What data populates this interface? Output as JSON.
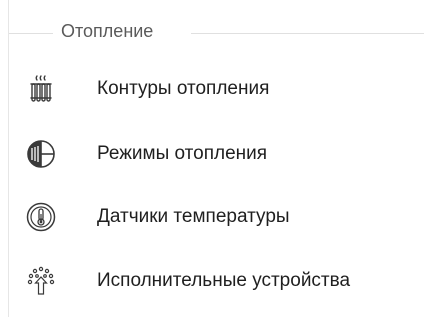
{
  "group": {
    "title": "Отопление"
  },
  "items": [
    {
      "label": "Контуры отопления",
      "icon": "radiator-icon"
    },
    {
      "label": "Режимы отопления",
      "icon": "heating-mode-icon"
    },
    {
      "label": "Датчики температуры",
      "icon": "thermometer-icon"
    },
    {
      "label": "Исполнительные устройства",
      "icon": "actuator-icon"
    }
  ],
  "colors": {
    "text": "#1f1f1f",
    "group_title": "#5a5a5a",
    "icon": "#3a3a3a",
    "divider": "#e0e0e0"
  }
}
